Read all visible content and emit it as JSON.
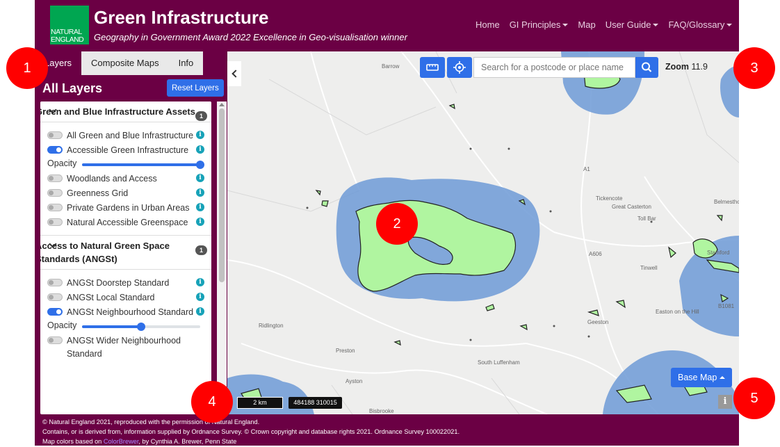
{
  "header": {
    "logo_line1": "NATURAL",
    "logo_line2": "ENGLAND",
    "title": "Green Infrastructure",
    "subtitle": "Geography in Government Award 2022 Excellence in Geo-visualisation winner",
    "nav": [
      "Home",
      "GI Principles",
      "Map",
      "User Guide",
      "FAQ/Glossary"
    ]
  },
  "sidebar": {
    "tabs": [
      "Layers",
      "Composite Maps",
      "Info"
    ],
    "active_tab": "Layers",
    "title": "All Layers",
    "reset_label": "Reset Layers",
    "opacity_label": "Opacity",
    "section1": {
      "title": "Green and Blue Infrastructure Assets",
      "badge": "1",
      "layers": [
        {
          "label": "All Green and Blue Infrastructure",
          "on": false
        },
        {
          "label": "Accessible Green Infrastructure",
          "on": true
        },
        {
          "label": "Woodlands and Access",
          "on": false
        },
        {
          "label": "Greenness Grid",
          "on": false
        },
        {
          "label": "Private Gardens in Urban Areas",
          "on": false
        },
        {
          "label": "Natural Accessible Greenspace",
          "on": false
        }
      ],
      "opacity": 1.0
    },
    "section2": {
      "title": "Access to Natural Green Space Standards (ANGSt)",
      "badge": "1",
      "layers": [
        {
          "label": "ANGSt Doorstep Standard",
          "on": false
        },
        {
          "label": "ANGSt Local Standard",
          "on": false
        },
        {
          "label": "ANGSt Neighbourhood Standard",
          "on": true
        },
        {
          "label": "ANGSt Wider Neighbourhood Standard",
          "on": false
        }
      ],
      "opacity": 0.5
    }
  },
  "map": {
    "search_placeholder": "Search for a postcode or place name",
    "zoom_label": "Zoom",
    "zoom_value": "11.9",
    "zoom_in": "+",
    "zoom_out": "−",
    "basemap_label": "Base Map",
    "scale": "2 km",
    "coords": "484188 310015",
    "info": "i",
    "places": [
      "Barrow",
      "A1",
      "Tickencote",
      "Great Casterton",
      "Belmesthor",
      "Toll Bar",
      "A606",
      "Tinwell",
      "Stamford",
      "B1081",
      "Easton on the Hill",
      "Geeston",
      "Ridlington",
      "Preston",
      "South Luffenham",
      "Ayston",
      "Bisbrooke"
    ],
    "colors": {
      "angst": "#6d9ad6",
      "green": "#b0f5a0",
      "outline": "#222222"
    }
  },
  "footer": {
    "line1": "© Natural England 2021, reproduced with the permission of Natural England.",
    "line2": "Contains, or is derived from, information supplied by Ordnance Survey. © Crown copyright and database rights 2021. Ordnance Survey 100022021.",
    "line3_prefix": "Map colors based on ",
    "line3_link": "ColorBrewer",
    "line3_suffix": ", by Cynthia A. Brewer, Penn State"
  },
  "callouts": [
    "1",
    "2",
    "3",
    "4",
    "5"
  ]
}
